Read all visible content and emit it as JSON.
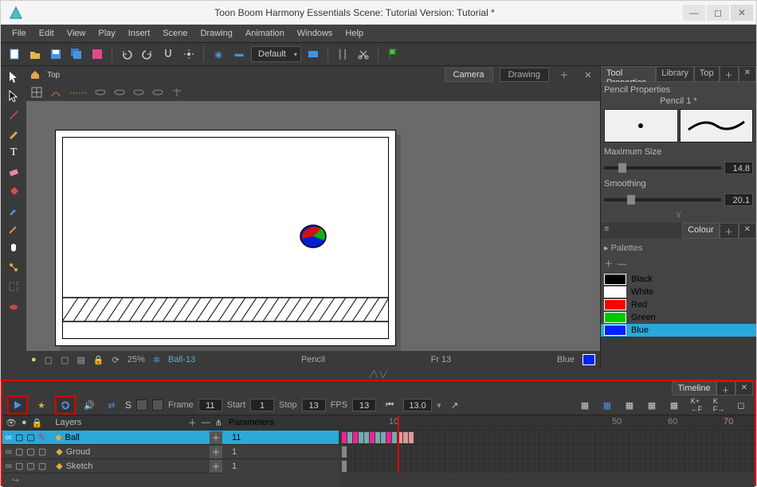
{
  "title": "Toon Boom Harmony Essentials Scene: Tutorial Version: Tutorial *",
  "menu": [
    "File",
    "Edit",
    "View",
    "Play",
    "Insert",
    "Scene",
    "Drawing",
    "Animation",
    "Windows",
    "Help"
  ],
  "combo_default": "Default",
  "top_tab": "Top",
  "viewport_tabs": {
    "camera": "Camera",
    "drawing": "Drawing"
  },
  "status": {
    "zoom": "25%",
    "layer": "Ball-13",
    "tool": "Pencil",
    "frame": "Fr 13",
    "colour": "Blue"
  },
  "tool_props": {
    "tabs": [
      "Tool Properties",
      "Library",
      "Top"
    ],
    "section": "Pencil Properties",
    "brush_name": "Pencil 1 *",
    "max_label": "Maximum Size",
    "max_val": "14.8",
    "smooth_label": "Smoothing",
    "smooth_val": "20.1"
  },
  "colour": {
    "tab": "Colour",
    "palettes": "Palettes",
    "items": [
      {
        "name": "Black",
        "hex": "#000000"
      },
      {
        "name": "White",
        "hex": "#ffffff"
      },
      {
        "name": "Red",
        "hex": "#ff0000"
      },
      {
        "name": "Green",
        "hex": "#00c800"
      },
      {
        "name": "Blue",
        "hex": "#0020ff"
      }
    ],
    "sel": 4
  },
  "timeline": {
    "tab": "Timeline",
    "layers_hdr": "Layers",
    "params_hdr": "Parameters",
    "frame_lbl": "Frame",
    "frame": "11",
    "start_lbl": "Start",
    "start": "1",
    "stop_lbl": "Stop",
    "stop": "13",
    "fps_lbl": "FPS",
    "fps": "13",
    "rate": "13.0",
    "s_lbl": "S",
    "ruler": {
      "a": "10",
      "b": "50",
      "c": "60",
      "d": "70"
    },
    "layers": [
      {
        "name": "Ball",
        "param": "11",
        "sel": true
      },
      {
        "name": "Groud",
        "param": "1",
        "sel": false
      },
      {
        "name": "Sketch",
        "param": "1",
        "sel": false
      }
    ]
  }
}
